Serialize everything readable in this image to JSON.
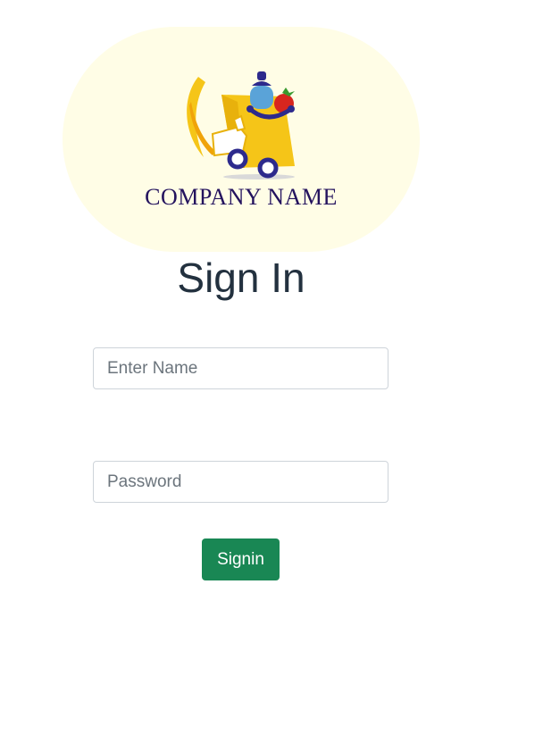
{
  "logo": {
    "company_name": "COMPANY NAME",
    "icon": "delivery-cart-logo",
    "background_color": "#fffde6",
    "brand_color": "#24135e",
    "accent_color": "#f5c518"
  },
  "form": {
    "title": "Sign In",
    "name_field": {
      "placeholder": "Enter Name",
      "value": ""
    },
    "password_field": {
      "placeholder": "Password",
      "value": ""
    },
    "submit_label": "Signin",
    "submit_color": "#198754"
  }
}
